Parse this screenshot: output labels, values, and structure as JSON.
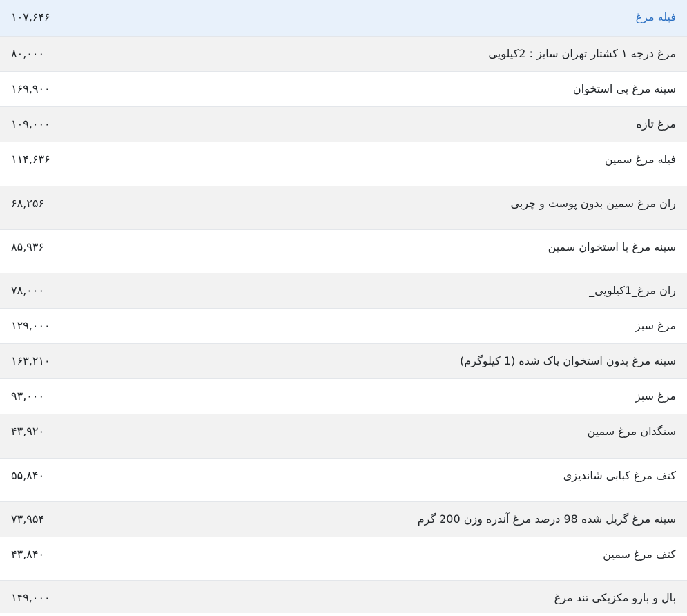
{
  "rows": [
    {
      "name": "فیله مرغ",
      "price": "۱۰۷,۶۴۶"
    },
    {
      "name": "مرغ درجه ۱ کشتار تهران سایز : 2کیلویی",
      "price": "۸۰,۰۰۰"
    },
    {
      "name": "سینه مرغ بی استخوان",
      "price": "۱۶۹,۹۰۰"
    },
    {
      "name": "مرغ تازه",
      "price": "۱۰۹,۰۰۰"
    },
    {
      "name": "فیله مرغ سمین",
      "price": "۱۱۴,۶۳۶"
    },
    {
      "name": "ران مرغ سمین بدون پوست و چربی",
      "price": "۶۸,۲۵۶"
    },
    {
      "name": "سینه مرغ با استخوان سمین",
      "price": "۸۵,۹۳۶"
    },
    {
      "name": "ران مرغ_1کیلویی_",
      "price": "۷۸,۰۰۰"
    },
    {
      "name": "مرغ سبز",
      "price": "۱۲۹,۰۰۰"
    },
    {
      "name": "سینه مرغ بدون استخوان پاک شده (1 کیلوگرم)",
      "price": "۱۶۳,۲۱۰"
    },
    {
      "name": "مرغ سبز",
      "price": "۹۳,۰۰۰"
    },
    {
      "name": "سنگدان مرغ سمین",
      "price": "۴۳,۹۲۰"
    },
    {
      "name": "کتف مرغ کبابی شاندیزی",
      "price": "۵۵,۸۴۰"
    },
    {
      "name": "سینه مرغ گریل شده 98 درصد مرغ آندره وزن 200 گرم",
      "price": "۷۳,۹۵۴"
    },
    {
      "name": "کتف مرغ سمین",
      "price": "۴۳,۸۴۰"
    },
    {
      "name": "بال و بازو مکزیکی تند مرغ",
      "price": "۱۴۹,۰۰۰"
    }
  ]
}
